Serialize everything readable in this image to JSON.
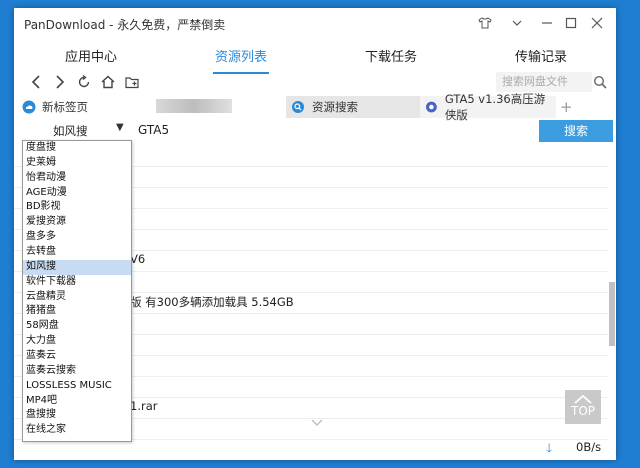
{
  "window": {
    "title": "PanDownload - 永久免费，严禁倒卖"
  },
  "main_tabs": [
    "应用中心",
    "资源列表",
    "下载任务",
    "传输记录"
  ],
  "active_main_tab": "资源列表",
  "navbar": {
    "search_placeholder": "搜索网盘文件"
  },
  "browser_tabs": {
    "new_tab": "新标签页",
    "resource_search": "资源搜索",
    "game_tab": "GTA5 v1.36高压游侠版",
    "add": "+"
  },
  "search": {
    "engine": "如风搜",
    "query": "GTA5",
    "button": "搜索"
  },
  "dropdown_options": [
    "度盘搜",
    "史莱姆",
    "怡君动漫",
    "AGE动漫",
    "BD影视",
    "爱搜资源",
    "盘多多",
    "去转盘",
    "如风搜",
    "软件下载器",
    "云盘精灵",
    "猪猪盘",
    "58网盘",
    "大力盘",
    "蓝奏云",
    "蓝奏云搜索",
    "LOSSLESS MUSIC",
    "MP4吧",
    "盘搜搜",
    "在线之家"
  ],
  "selected_option": "如风搜",
  "results": [
    {
      "text": ""
    },
    {
      "text": ""
    },
    {
      "text": ""
    },
    {
      "text": ""
    },
    {
      "text": ""
    },
    {
      "text": "V6"
    },
    {
      "text": ""
    },
    {
      "text": "版 有300多辆添加载具 5.54GB"
    },
    {
      "text": ""
    },
    {
      "text": ""
    },
    {
      "text": ""
    },
    {
      "text": ""
    },
    {
      "text": "1.rar"
    },
    {
      "text": ""
    }
  ],
  "top_button": "TOP",
  "status": {
    "speed": "0B/s"
  }
}
